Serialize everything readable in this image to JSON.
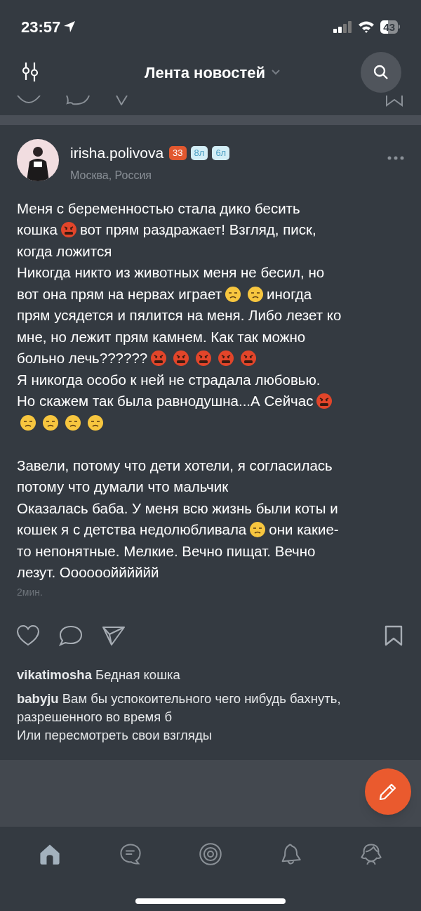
{
  "status_bar": {
    "time": "23:57",
    "battery": "43"
  },
  "header": {
    "title": "Лента новостей"
  },
  "post": {
    "author": "irisha.polivova",
    "badges": [
      {
        "text": "33",
        "kind": "age"
      },
      {
        "text": "8л",
        "kind": "child"
      },
      {
        "text": "6л",
        "kind": "child"
      }
    ],
    "location": "Москва, Россия",
    "paragraphs": [
      [
        {
          "kind": "text",
          "text": "Меня с беременностью стала дико бесить"
        }
      ],
      [
        {
          "kind": "text",
          "text": "кошка"
        },
        {
          "kind": "angry"
        },
        {
          "kind": "text",
          "text": "вот прям раздражает! Взгляд, писк,"
        }
      ],
      [
        {
          "kind": "text",
          "text": "когда ложится"
        }
      ],
      [
        {
          "kind": "text",
          "text": "Никогда никто из животных меня не бесил, но"
        }
      ],
      [
        {
          "kind": "text",
          "text": "вот она прям на нервах играет"
        },
        {
          "kind": "face"
        },
        {
          "kind": "face"
        },
        {
          "kind": "text",
          "text": "иногда"
        }
      ],
      [
        {
          "kind": "text",
          "text": "прям усядется и пялится на меня. Либо лезет ко"
        }
      ],
      [
        {
          "kind": "text",
          "text": "мне, но лежит прям камнем. Как так можно"
        }
      ],
      [
        {
          "kind": "text",
          "text": "больно лечь??????"
        },
        {
          "kind": "angry"
        },
        {
          "kind": "angry"
        },
        {
          "kind": "angry"
        },
        {
          "kind": "angry"
        },
        {
          "kind": "angry"
        }
      ],
      [
        {
          "kind": "text",
          "text": "Я никогда особо к ней не страдала любовью."
        }
      ],
      [
        {
          "kind": "text",
          "text": "Но скажем так была равнодушна...А Сейчас"
        },
        {
          "kind": "angry"
        }
      ],
      [
        {
          "kind": "face"
        },
        {
          "kind": "face"
        },
        {
          "kind": "face"
        },
        {
          "kind": "face"
        }
      ],
      [
        {
          "kind": "gap"
        }
      ],
      [
        {
          "kind": "text",
          "text": "Завели, потому что дети хотели, я согласилась"
        }
      ],
      [
        {
          "kind": "text",
          "text": "потому что думали что мальчик"
        }
      ],
      [
        {
          "kind": "text",
          "text": "Оказалась баба. У меня всю жизнь были коты и"
        }
      ],
      [
        {
          "kind": "text",
          "text": "кошек я с детства недолюбливала"
        },
        {
          "kind": "face"
        },
        {
          "kind": "text",
          "text": "они какие-"
        }
      ],
      [
        {
          "kind": "text",
          "text": "то непонятные. Мелкие. Вечно пищат. Вечно"
        }
      ],
      [
        {
          "kind": "text",
          "text": "лезут. Оооооойййййй"
        }
      ]
    ],
    "time": "2мин.",
    "comments": [
      "**vikatimosha** Бедная кошка",
      "**babyju** Вам бы успокоительного чего нибудь бахнуть, разрешенного во время б\nИли пересмотреть свои взгляды"
    ]
  },
  "tab_bar": [
    {
      "kind": "home",
      "selected": true
    },
    {
      "kind": "chat",
      "selected": false
    },
    {
      "kind": "target",
      "selected": false
    },
    {
      "kind": "bell",
      "selected": false
    },
    {
      "kind": "profile",
      "selected": false
    }
  ]
}
